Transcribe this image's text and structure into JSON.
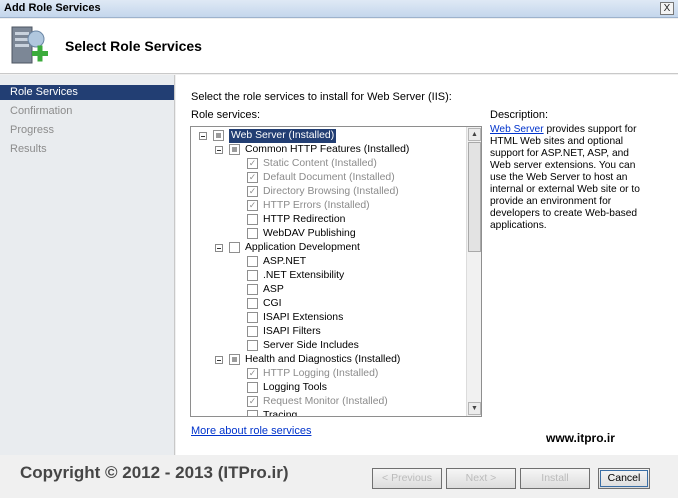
{
  "window": {
    "title": "Add Role Services",
    "close_glyph": "X"
  },
  "header": {
    "page_title": "Select Role Services",
    "icon": "server-add-icon"
  },
  "sidebar": {
    "items": [
      {
        "label": "Role Services",
        "active": true
      },
      {
        "label": "Confirmation",
        "active": false
      },
      {
        "label": "Progress",
        "active": false
      },
      {
        "label": "Results",
        "active": false
      }
    ]
  },
  "main": {
    "instruction": "Select the role services to install for Web Server (IIS):",
    "roles_label": "Role services:",
    "description_heading": "Description:",
    "description_link": "Web Server",
    "description_text": " provides support for HTML Web sites and optional support for ASP.NET, ASP, and Web server extensions. You can use the Web Server to host an internal or external Web site or to provide an environment for developers to create Web-based applications.",
    "more_link": "More about role services"
  },
  "tree": [
    {
      "label": "Web Server  (Installed)",
      "level": 0,
      "expander": true,
      "check": "partial",
      "selected": true,
      "grey": false
    },
    {
      "label": "Common HTTP Features  (Installed)",
      "level": 1,
      "expander": true,
      "check": "partial",
      "selected": false,
      "grey": false
    },
    {
      "label": "Static Content  (Installed)",
      "level": 2,
      "expander": false,
      "check": "checked",
      "selected": false,
      "grey": true
    },
    {
      "label": "Default Document  (Installed)",
      "level": 2,
      "expander": false,
      "check": "checked",
      "selected": false,
      "grey": true
    },
    {
      "label": "Directory Browsing  (Installed)",
      "level": 2,
      "expander": false,
      "check": "checked",
      "selected": false,
      "grey": true
    },
    {
      "label": "HTTP Errors  (Installed)",
      "level": 2,
      "expander": false,
      "check": "checked",
      "selected": false,
      "grey": true
    },
    {
      "label": "HTTP Redirection",
      "level": 2,
      "expander": false,
      "check": "empty",
      "selected": false,
      "grey": false
    },
    {
      "label": "WebDAV Publishing",
      "level": 2,
      "expander": false,
      "check": "empty",
      "selected": false,
      "grey": false
    },
    {
      "label": "Application Development",
      "level": 1,
      "expander": true,
      "check": "empty",
      "selected": false,
      "grey": false
    },
    {
      "label": "ASP.NET",
      "level": 2,
      "expander": false,
      "check": "empty",
      "selected": false,
      "grey": false
    },
    {
      "label": ".NET Extensibility",
      "level": 2,
      "expander": false,
      "check": "empty",
      "selected": false,
      "grey": false
    },
    {
      "label": "ASP",
      "level": 2,
      "expander": false,
      "check": "empty",
      "selected": false,
      "grey": false
    },
    {
      "label": "CGI",
      "level": 2,
      "expander": false,
      "check": "empty",
      "selected": false,
      "grey": false
    },
    {
      "label": "ISAPI Extensions",
      "level": 2,
      "expander": false,
      "check": "empty",
      "selected": false,
      "grey": false
    },
    {
      "label": "ISAPI Filters",
      "level": 2,
      "expander": false,
      "check": "empty",
      "selected": false,
      "grey": false
    },
    {
      "label": "Server Side Includes",
      "level": 2,
      "expander": false,
      "check": "empty",
      "selected": false,
      "grey": false
    },
    {
      "label": "Health and Diagnostics  (Installed)",
      "level": 1,
      "expander": true,
      "check": "partial",
      "selected": false,
      "grey": false
    },
    {
      "label": "HTTP Logging  (Installed)",
      "level": 2,
      "expander": false,
      "check": "checked",
      "selected": false,
      "grey": true
    },
    {
      "label": "Logging Tools",
      "level": 2,
      "expander": false,
      "check": "empty",
      "selected": false,
      "grey": false
    },
    {
      "label": "Request Monitor  (Installed)",
      "level": 2,
      "expander": false,
      "check": "checked",
      "selected": false,
      "grey": true
    },
    {
      "label": "Tracing",
      "level": 2,
      "expander": false,
      "check": "empty",
      "selected": false,
      "grey": false
    }
  ],
  "watermark": {
    "site": "www.itpro.ir",
    "copyright": "Copyright © 2012 - 2013 (ITPro.ir)"
  },
  "buttons": {
    "previous": "< Previous",
    "next": "Next >",
    "install": "Install",
    "cancel": "Cancel"
  }
}
